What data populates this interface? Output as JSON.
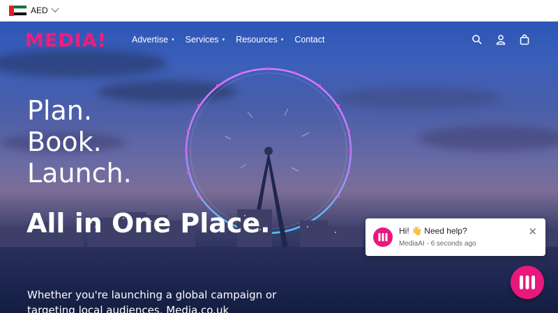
{
  "topbar": {
    "currency": "AED"
  },
  "nav": {
    "logo_text": "MEDIA!",
    "items": [
      {
        "label": "Advertise",
        "has_dropdown": true
      },
      {
        "label": "Services",
        "has_dropdown": true
      },
      {
        "label": "Resources",
        "has_dropdown": true
      },
      {
        "label": "Contact",
        "has_dropdown": false
      }
    ],
    "caret": "▾",
    "icons": [
      "search-icon",
      "account-icon",
      "cart-icon"
    ]
  },
  "hero": {
    "line1": "Plan.",
    "line2": "Book.",
    "line3": "Launch.",
    "headline": "All in One Place.",
    "subtext": "Whether you're launching a global campaign or targeting local audiences, Media.co.uk"
  },
  "chat": {
    "message": "Hi! 👋 Need help?",
    "meta": "MediaAI - 6 seconds ago",
    "close": "✕"
  },
  "colors": {
    "brand": "#e8187c",
    "white": "#ffffff"
  }
}
